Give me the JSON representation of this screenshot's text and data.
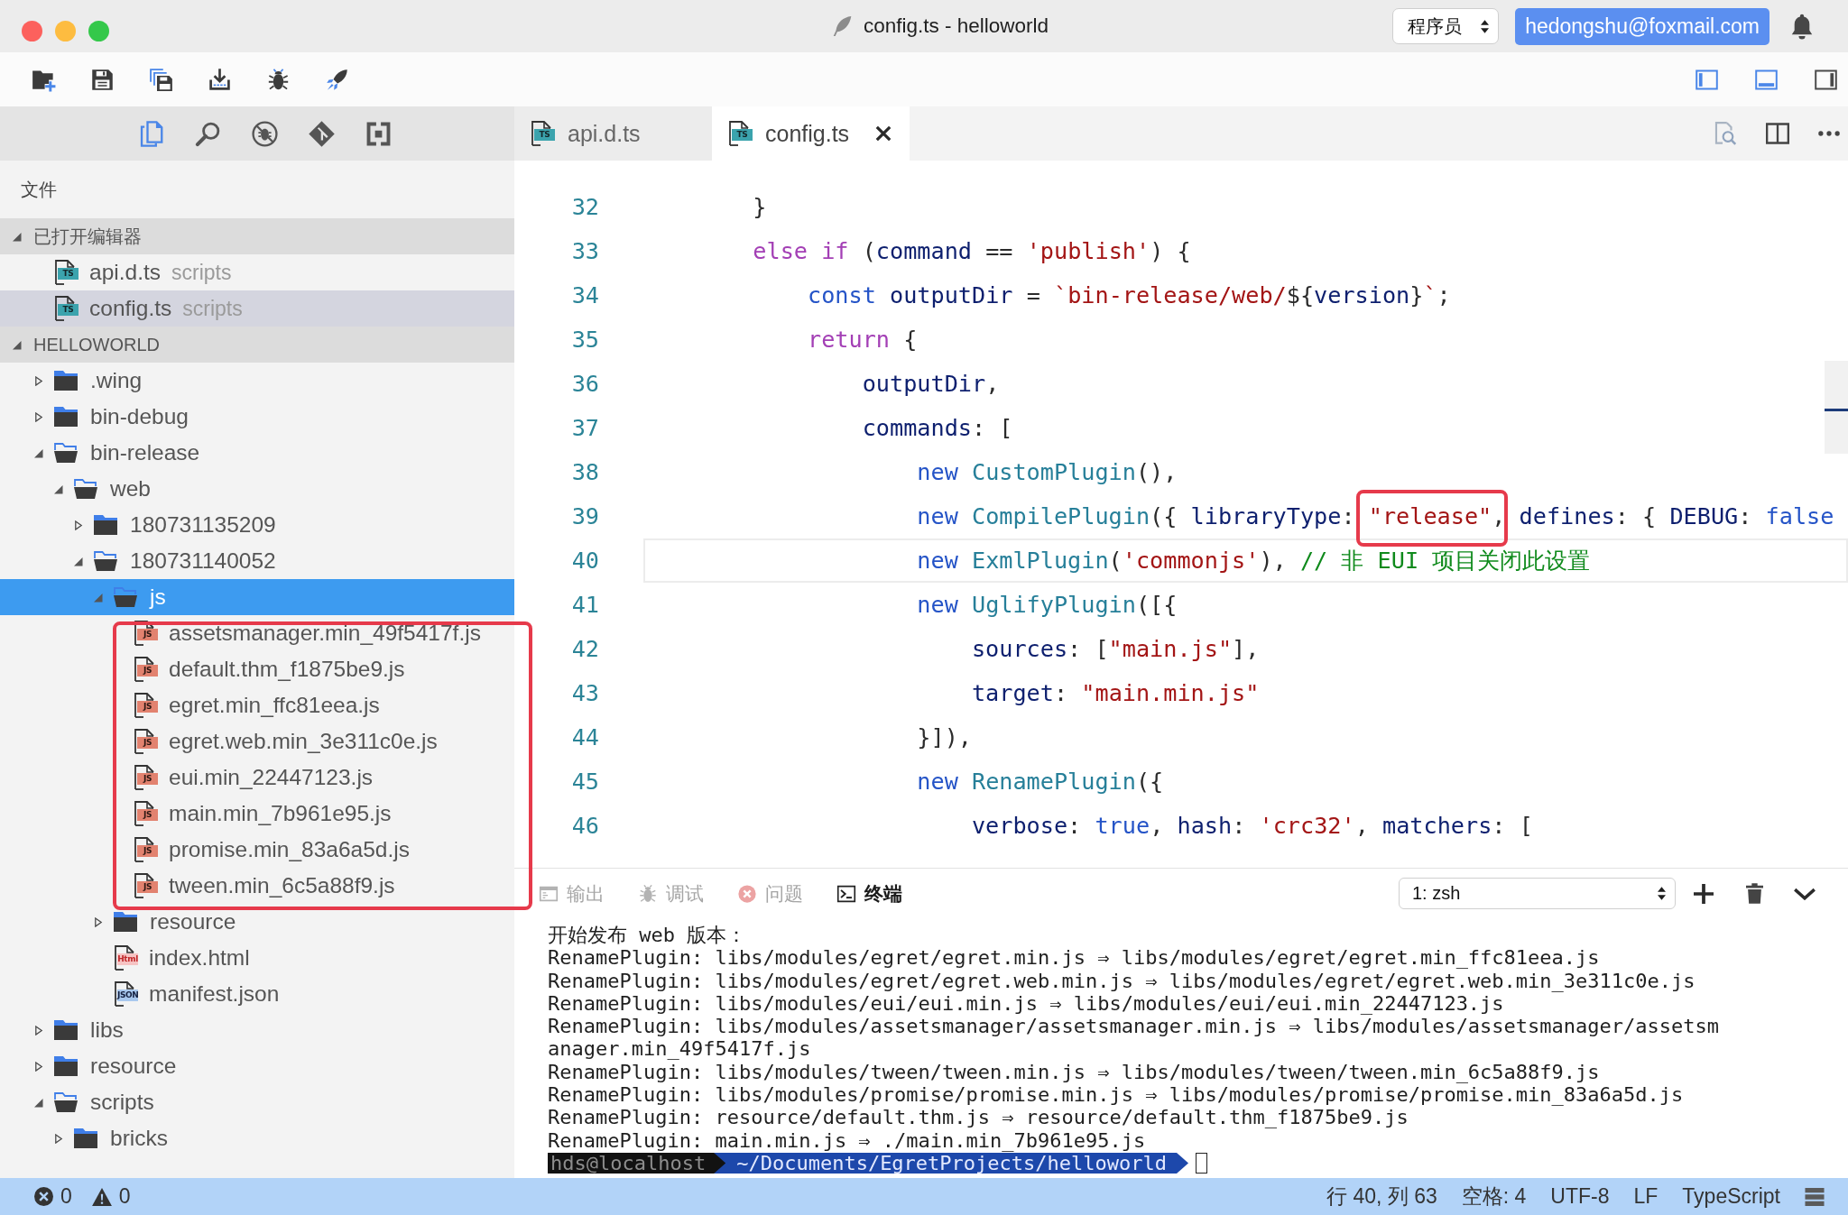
{
  "window": {
    "title": "config.ts - helloworld"
  },
  "header": {
    "role": "程序员",
    "account": "hedongshu@foxmail.com"
  },
  "layout_toggles": [
    {
      "on": true
    },
    {
      "on": true
    },
    {
      "on": false
    }
  ],
  "activity_bar": [
    {
      "selected": true
    },
    {
      "selected": false
    },
    {
      "selected": false
    },
    {
      "selected": false
    },
    {
      "selected": false
    }
  ],
  "sidebar": {
    "title": "文件",
    "sections": [
      {
        "kind": "editors",
        "title": "已打开编辑器",
        "expanded": true,
        "items": [
          {
            "label": "api.d.ts",
            "detail": "scripts",
            "kind": "ts",
            "badge": "TS",
            "selected": false
          },
          {
            "label": "config.ts",
            "detail": "scripts",
            "kind": "ts",
            "badge": "TS",
            "selected": true
          }
        ]
      },
      {
        "kind": "tree",
        "title": "HELLOWORLD",
        "expanded": true,
        "items": [
          {
            "label": ".wing",
            "kind": "folder",
            "expanded": false,
            "selected": false
          },
          {
            "label": "bin-debug",
            "kind": "folder",
            "expanded": false,
            "selected": false
          },
          {
            "label": "bin-release",
            "kind": "folder",
            "expanded": true,
            "selected": false,
            "children": [
              {
                "label": "web",
                "kind": "folder",
                "expanded": true,
                "selected": false,
                "children": [
                  {
                    "label": "180731135209",
                    "kind": "folder",
                    "expanded": false,
                    "selected": false
                  },
                  {
                    "label": "180731140052",
                    "kind": "folder",
                    "expanded": true,
                    "selected": false,
                    "children": [
                      {
                        "label": "js",
                        "kind": "folder",
                        "expanded": true,
                        "selected": true,
                        "children_framed": true,
                        "children": [
                          {
                            "label": "assetsmanager.min_49f5417f.js",
                            "kind": "js",
                            "badge": "JS",
                            "selected": false
                          },
                          {
                            "label": "default.thm_f1875be9.js",
                            "kind": "js",
                            "badge": "JS",
                            "selected": false
                          },
                          {
                            "label": "egret.min_ffc81eea.js",
                            "kind": "js",
                            "badge": "JS",
                            "selected": false
                          },
                          {
                            "label": "egret.web.min_3e311c0e.js",
                            "kind": "js",
                            "badge": "JS",
                            "selected": false
                          },
                          {
                            "label": "eui.min_22447123.js",
                            "kind": "js",
                            "badge": "JS",
                            "selected": false
                          },
                          {
                            "label": "main.min_7b961e95.js",
                            "kind": "js",
                            "badge": "JS",
                            "selected": false
                          },
                          {
                            "label": "promise.min_83a6a5d.js",
                            "kind": "js",
                            "badge": "JS",
                            "selected": false
                          },
                          {
                            "label": "tween.min_6c5a88f9.js",
                            "kind": "js",
                            "badge": "JS",
                            "selected": false
                          }
                        ]
                      },
                      {
                        "label": "resource",
                        "kind": "folder",
                        "expanded": false,
                        "selected": false
                      },
                      {
                        "label": "index.html",
                        "kind": "html",
                        "badge": "Html",
                        "selected": false
                      },
                      {
                        "label": "manifest.json",
                        "kind": "json",
                        "badge": "JSON",
                        "selected": false
                      }
                    ]
                  }
                ]
              }
            ]
          },
          {
            "label": "libs",
            "kind": "folder",
            "expanded": false,
            "selected": false
          },
          {
            "label": "resource",
            "kind": "folder",
            "expanded": false,
            "selected": false
          },
          {
            "label": "scripts",
            "kind": "folder",
            "expanded": true,
            "selected": false,
            "children": [
              {
                "label": "bricks",
                "kind": "folder",
                "expanded": false,
                "selected": false
              }
            ]
          }
        ]
      }
    ]
  },
  "tabs": [
    {
      "label": "api.d.ts",
      "kind": "ts",
      "badge": "TS",
      "selected": false
    },
    {
      "label": "config.ts",
      "kind": "ts",
      "badge": "TS",
      "selected": true
    }
  ],
  "editor": {
    "lines": [
      {
        "number": "32",
        "current": false,
        "tokens": [
          {
            "kind": "plain",
            "text": "        }"
          }
        ]
      },
      {
        "number": "33",
        "current": false,
        "tokens": [
          {
            "kind": "control",
            "text": "        else if"
          },
          {
            "kind": "plain",
            "text": " ("
          },
          {
            "kind": "variable",
            "text": "command"
          },
          {
            "kind": "plain",
            "text": " == "
          },
          {
            "kind": "string",
            "text": "'publish'"
          },
          {
            "kind": "plain",
            "text": ") {"
          }
        ]
      },
      {
        "number": "34",
        "current": false,
        "tokens": [
          {
            "kind": "keyword",
            "text": "            const"
          },
          {
            "kind": "variable",
            "text": " outputDir"
          },
          {
            "kind": "plain",
            "text": " = "
          },
          {
            "kind": "string",
            "text": "`bin-release/web/"
          },
          {
            "kind": "plain",
            "text": "${"
          },
          {
            "kind": "variable",
            "text": "version"
          },
          {
            "kind": "plain",
            "text": "}"
          },
          {
            "kind": "string",
            "text": "`"
          },
          {
            "kind": "plain",
            "text": ";"
          }
        ]
      },
      {
        "number": "35",
        "current": false,
        "tokens": [
          {
            "kind": "control",
            "text": "            return"
          },
          {
            "kind": "plain",
            "text": " {"
          }
        ]
      },
      {
        "number": "36",
        "current": false,
        "tokens": [
          {
            "kind": "variable",
            "text": "                outputDir"
          },
          {
            "kind": "plain",
            "text": ","
          }
        ]
      },
      {
        "number": "37",
        "current": false,
        "tokens": [
          {
            "kind": "variable",
            "text": "                commands"
          },
          {
            "kind": "plain",
            "text": ": ["
          }
        ]
      },
      {
        "number": "38",
        "current": false,
        "tokens": [
          {
            "kind": "keyword",
            "text": "                    new"
          },
          {
            "kind": "type",
            "text": " CustomPlugin"
          },
          {
            "kind": "plain",
            "text": "(),"
          }
        ]
      },
      {
        "number": "39",
        "current": false,
        "tokens": [
          {
            "kind": "keyword",
            "text": "                    new"
          },
          {
            "kind": "type",
            "text": " CompilePlugin"
          },
          {
            "kind": "plain",
            "text": "({ "
          },
          {
            "kind": "variable",
            "text": "libraryType"
          },
          {
            "kind": "plain",
            "text": ": "
          },
          {
            "kind": "string",
            "text": "\"release\"",
            "framed": true
          },
          {
            "kind": "plain",
            "text": ", "
          },
          {
            "kind": "variable",
            "text": "defines"
          },
          {
            "kind": "plain",
            "text": ": { "
          },
          {
            "kind": "variable",
            "text": "DEBUG"
          },
          {
            "kind": "plain",
            "text": ": "
          },
          {
            "kind": "keyword",
            "text": "false"
          }
        ]
      },
      {
        "number": "40",
        "current": true,
        "tokens": [
          {
            "kind": "keyword",
            "text": "                    new"
          },
          {
            "kind": "type",
            "text": " ExmlPlugin"
          },
          {
            "kind": "plain",
            "text": "("
          },
          {
            "kind": "string",
            "text": "'commonjs'"
          },
          {
            "kind": "plain",
            "text": "), "
          },
          {
            "kind": "comment",
            "text": "// 非 EUI 项目关闭此设置"
          }
        ]
      },
      {
        "number": "41",
        "current": false,
        "tokens": [
          {
            "kind": "keyword",
            "text": "                    new"
          },
          {
            "kind": "type",
            "text": " UglifyPlugin"
          },
          {
            "kind": "plain",
            "text": "([{"
          }
        ]
      },
      {
        "number": "42",
        "current": false,
        "tokens": [
          {
            "kind": "variable",
            "text": "                        sources"
          },
          {
            "kind": "plain",
            "text": ": ["
          },
          {
            "kind": "string",
            "text": "\"main.js\""
          },
          {
            "kind": "plain",
            "text": "],"
          }
        ]
      },
      {
        "number": "43",
        "current": false,
        "tokens": [
          {
            "kind": "variable",
            "text": "                        target"
          },
          {
            "kind": "plain",
            "text": ": "
          },
          {
            "kind": "string",
            "text": "\"main.min.js\""
          }
        ]
      },
      {
        "number": "44",
        "current": false,
        "tokens": [
          {
            "kind": "plain",
            "text": "                    }]),"
          }
        ]
      },
      {
        "number": "45",
        "current": false,
        "tokens": [
          {
            "kind": "keyword",
            "text": "                    new"
          },
          {
            "kind": "type",
            "text": " RenamePlugin"
          },
          {
            "kind": "plain",
            "text": "({"
          }
        ]
      },
      {
        "number": "46",
        "current": false,
        "tokens": [
          {
            "kind": "variable",
            "text": "                        verbose"
          },
          {
            "kind": "plain",
            "text": ": "
          },
          {
            "kind": "keyword",
            "text": "true"
          },
          {
            "kind": "plain",
            "text": ", "
          },
          {
            "kind": "variable",
            "text": "hash"
          },
          {
            "kind": "plain",
            "text": ": "
          },
          {
            "kind": "string",
            "text": "'crc32'"
          },
          {
            "kind": "plain",
            "text": ", "
          },
          {
            "kind": "variable",
            "text": "matchers"
          },
          {
            "kind": "plain",
            "text": ": ["
          }
        ]
      }
    ]
  },
  "panel": {
    "tabs": [
      {
        "label": "输出",
        "selected": false
      },
      {
        "label": "调试",
        "selected": false
      },
      {
        "label": "问题",
        "selected": false
      },
      {
        "label": "终端",
        "selected": true
      }
    ],
    "terminal_select": "1: zsh",
    "output": [
      "开始发布 web 版本：",
      "RenamePlugin: libs/modules/egret/egret.min.js ⇒ libs/modules/egret/egret.min_ffc81eea.js",
      "RenamePlugin: libs/modules/egret/egret.web.min.js ⇒ libs/modules/egret/egret.web.min_3e311c0e.js",
      "RenamePlugin: libs/modules/eui/eui.min.js ⇒ libs/modules/eui/eui.min_22447123.js",
      "RenamePlugin: libs/modules/assetsmanager/assetsmanager.min.js ⇒ libs/modules/assetsmanager/assetsm",
      "anager.min_49f5417f.js",
      "RenamePlugin: libs/modules/tween/tween.min.js ⇒ libs/modules/tween/tween.min_6c5a88f9.js",
      "RenamePlugin: libs/modules/promise/promise.min.js ⇒ libs/modules/promise/promise.min_83a6a5d.js",
      "RenamePlugin: resource/default.thm.js ⇒ resource/default.thm_f1875be9.js",
      "RenamePlugin: main.min.js ⇒ ./main.min_7b961e95.js"
    ],
    "prompt": {
      "user": "hds@localhost",
      "path": "~/Documents/EgretProjects/helloworld"
    }
  },
  "status_bar": {
    "errors": "0",
    "warnings": "0",
    "items": [
      "行 40, 列 63",
      "空格: 4",
      "UTF-8",
      "LF",
      "TypeScript"
    ]
  }
}
